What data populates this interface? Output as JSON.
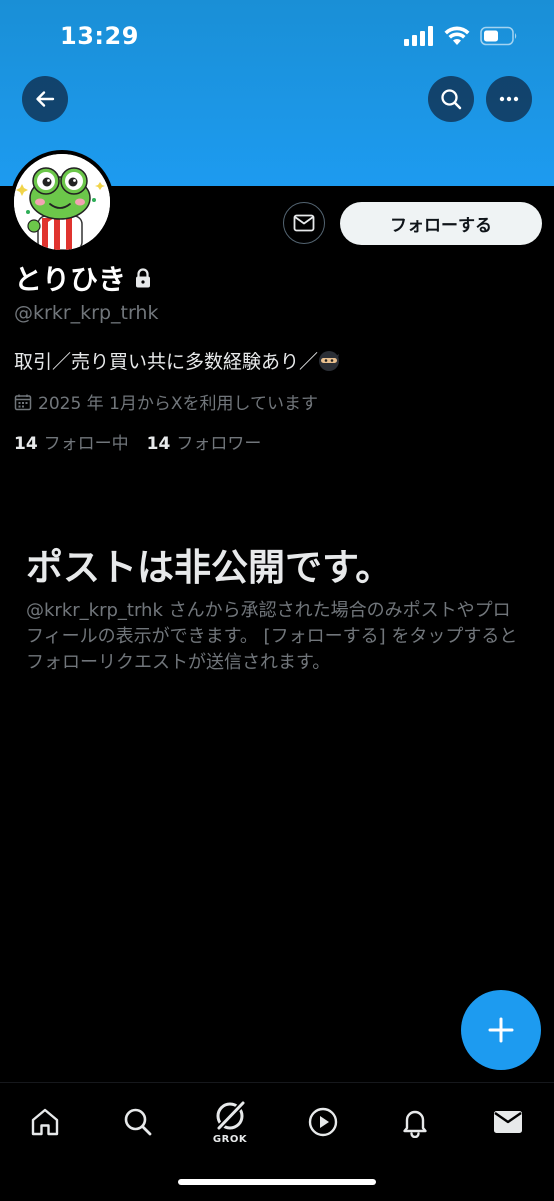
{
  "status_bar": {
    "time": "13:29"
  },
  "header": {
    "back_icon": "arrow-left-icon",
    "search_icon": "search-icon",
    "more_icon": "more-horizontal-icon",
    "banner_color": "#1d9bf0"
  },
  "profile": {
    "display_name": "とりひき",
    "lock_icon": "lock-icon",
    "handle": "@krkr_krp_trhk",
    "bio": "取引／売り買い共に多数経験あり／",
    "bio_emoji": "ninja-emoji",
    "joined": "2025 年 1月からXを利用しています",
    "following_count": "14",
    "following_label": "フォロー中",
    "followers_count": "14",
    "followers_label": "フォロワー"
  },
  "actions": {
    "message_icon": "mail-icon",
    "follow_label": "フォローする"
  },
  "private_notice": {
    "title": "ポストは非公開です。",
    "description": "@krkr_krp_trhk さんから承認された場合のみポストやプロフィールの表示ができます。 [フォローする] をタップするとフォローリクエストが送信されます。"
  },
  "tabbar": {
    "grok_label": "GROK"
  },
  "colors": {
    "accent": "#1d9bf0",
    "muted_text": "#71767b",
    "background": "#000000"
  }
}
